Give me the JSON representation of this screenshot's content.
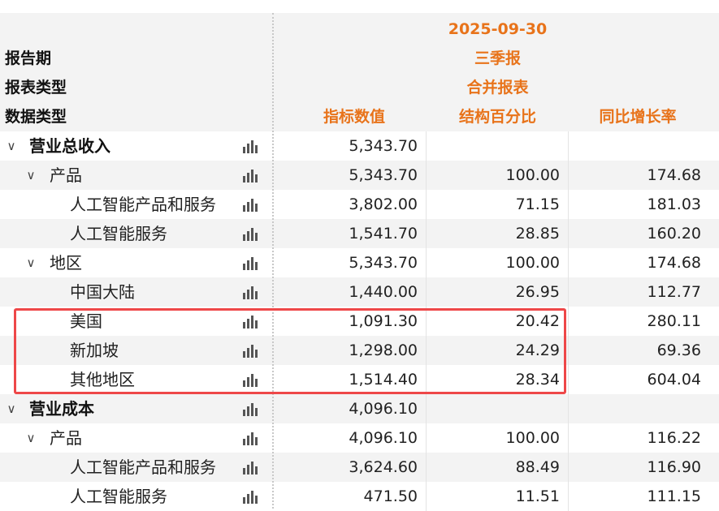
{
  "header": {
    "labels": {
      "report_period": "报告期",
      "report_type": "报表类型",
      "data_type": "数据类型"
    },
    "period": {
      "date": "2025-09-30",
      "quarter": "三季报",
      "statement": "合并报表"
    },
    "columns": {
      "value": "指标数值",
      "percent": "结构百分比",
      "growth": "同比增长率"
    }
  },
  "rows": [
    {
      "name": "营业总收入",
      "level": 0,
      "expand": "∨",
      "value": "5,343.70",
      "percent": "",
      "growth": ""
    },
    {
      "name": "产品",
      "level": 1,
      "expand": "∨",
      "value": "5,343.70",
      "percent": "100.00",
      "growth": "174.68"
    },
    {
      "name": "人工智能产品和服务",
      "level": 2,
      "expand": "",
      "value": "3,802.00",
      "percent": "71.15",
      "growth": "181.03"
    },
    {
      "name": "人工智能服务",
      "level": 2,
      "expand": "",
      "value": "1,541.70",
      "percent": "28.85",
      "growth": "160.20"
    },
    {
      "name": "地区",
      "level": 1,
      "expand": "∨",
      "value": "5,343.70",
      "percent": "100.00",
      "growth": "174.68"
    },
    {
      "name": "中国大陆",
      "level": 2,
      "expand": "",
      "value": "1,440.00",
      "percent": "26.95",
      "growth": "112.77"
    },
    {
      "name": "美国",
      "level": 2,
      "expand": "",
      "value": "1,091.30",
      "percent": "20.42",
      "growth": "280.11"
    },
    {
      "name": "新加坡",
      "level": 2,
      "expand": "",
      "value": "1,298.00",
      "percent": "24.29",
      "growth": "69.36"
    },
    {
      "name": "其他地区",
      "level": 2,
      "expand": "",
      "value": "1,514.40",
      "percent": "28.34",
      "growth": "604.04"
    },
    {
      "name": "营业成本",
      "level": 0,
      "expand": "∨",
      "value": "4,096.10",
      "percent": "",
      "growth": ""
    },
    {
      "name": "产品",
      "level": 1,
      "expand": "∨",
      "value": "4,096.10",
      "percent": "100.00",
      "growth": "116.22"
    },
    {
      "name": "人工智能产品和服务",
      "level": 2,
      "expand": "",
      "value": "3,624.60",
      "percent": "88.49",
      "growth": "116.90"
    },
    {
      "name": "人工智能服务",
      "level": 2,
      "expand": "",
      "value": "471.50",
      "percent": "11.51",
      "growth": "111.15"
    }
  ],
  "icons": {
    "chart": "bar-chart-icon",
    "expand": "chevron-down-icon"
  },
  "colors": {
    "accent": "#e8731a",
    "highlight": "#ee4748",
    "row_alt": "#f3f3f3"
  }
}
